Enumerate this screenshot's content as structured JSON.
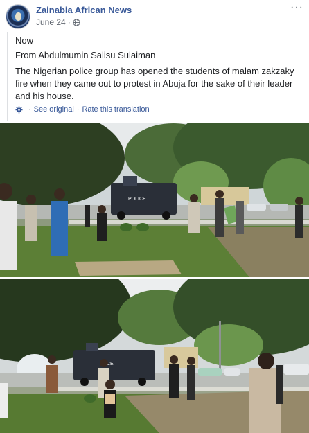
{
  "header": {
    "page_name": "Zainabia African News",
    "date": "June 24",
    "separator": "·",
    "more_label": "···"
  },
  "translation": {
    "label": "Now",
    "attribution": "From Abdulmumin Salisu Sulaiman",
    "body": "The Nigerian police group has opened the students of malam zakzaky fire when they came out to protest in Abuja for the sake of their leader and his house.",
    "see_original": "See original",
    "separator": "·",
    "rate_translation": "Rate this translation"
  },
  "photos": [
    {
      "vehicle_text": "POLICE"
    },
    {
      "vehicle_text": "ICE"
    }
  ],
  "icons": {
    "avatar": "page-avatar",
    "privacy": "globe-icon",
    "settings": "gear-icon",
    "more": "ellipsis-icon"
  }
}
